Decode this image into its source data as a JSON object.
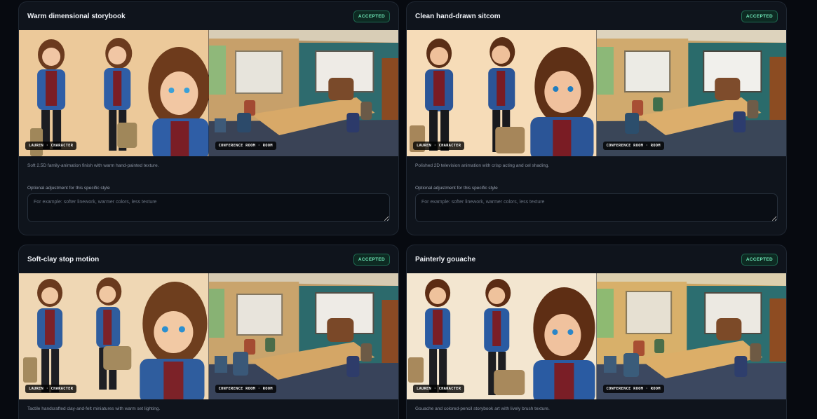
{
  "tag_labels": {
    "character": "LAUREN · CHARACTER",
    "room": "CONFERENCE ROOM · ROOM"
  },
  "adjust_label": "Optional adjustment for this specific style",
  "adjust_placeholder": "For example: softer linework, warmer colors, less texture",
  "cards": [
    {
      "title": "Warm dimensional storybook",
      "status": "ACCEPTED",
      "description": "Soft 2.5D family-animation finish with warm hand-painted texture."
    },
    {
      "title": "Clean hand-drawn sitcom",
      "status": "ACCEPTED",
      "description": "Polished 2D television animation with crisp acting and cel shading."
    },
    {
      "title": "Soft-clay stop motion",
      "status": "ACCEPTED",
      "description": "Tactile handcrafted clay-and-felt miniatures with warm set lighting."
    },
    {
      "title": "Painterly gouache",
      "status": "ACCEPTED",
      "description": "Gouache and colored-pencil storybook art with lively brush texture."
    }
  ],
  "colors": {
    "accepted_text": "#6ee7b7",
    "accepted_bg": "#0d2a22",
    "card_bg": "#0f141c",
    "page_bg": "#070a10"
  }
}
